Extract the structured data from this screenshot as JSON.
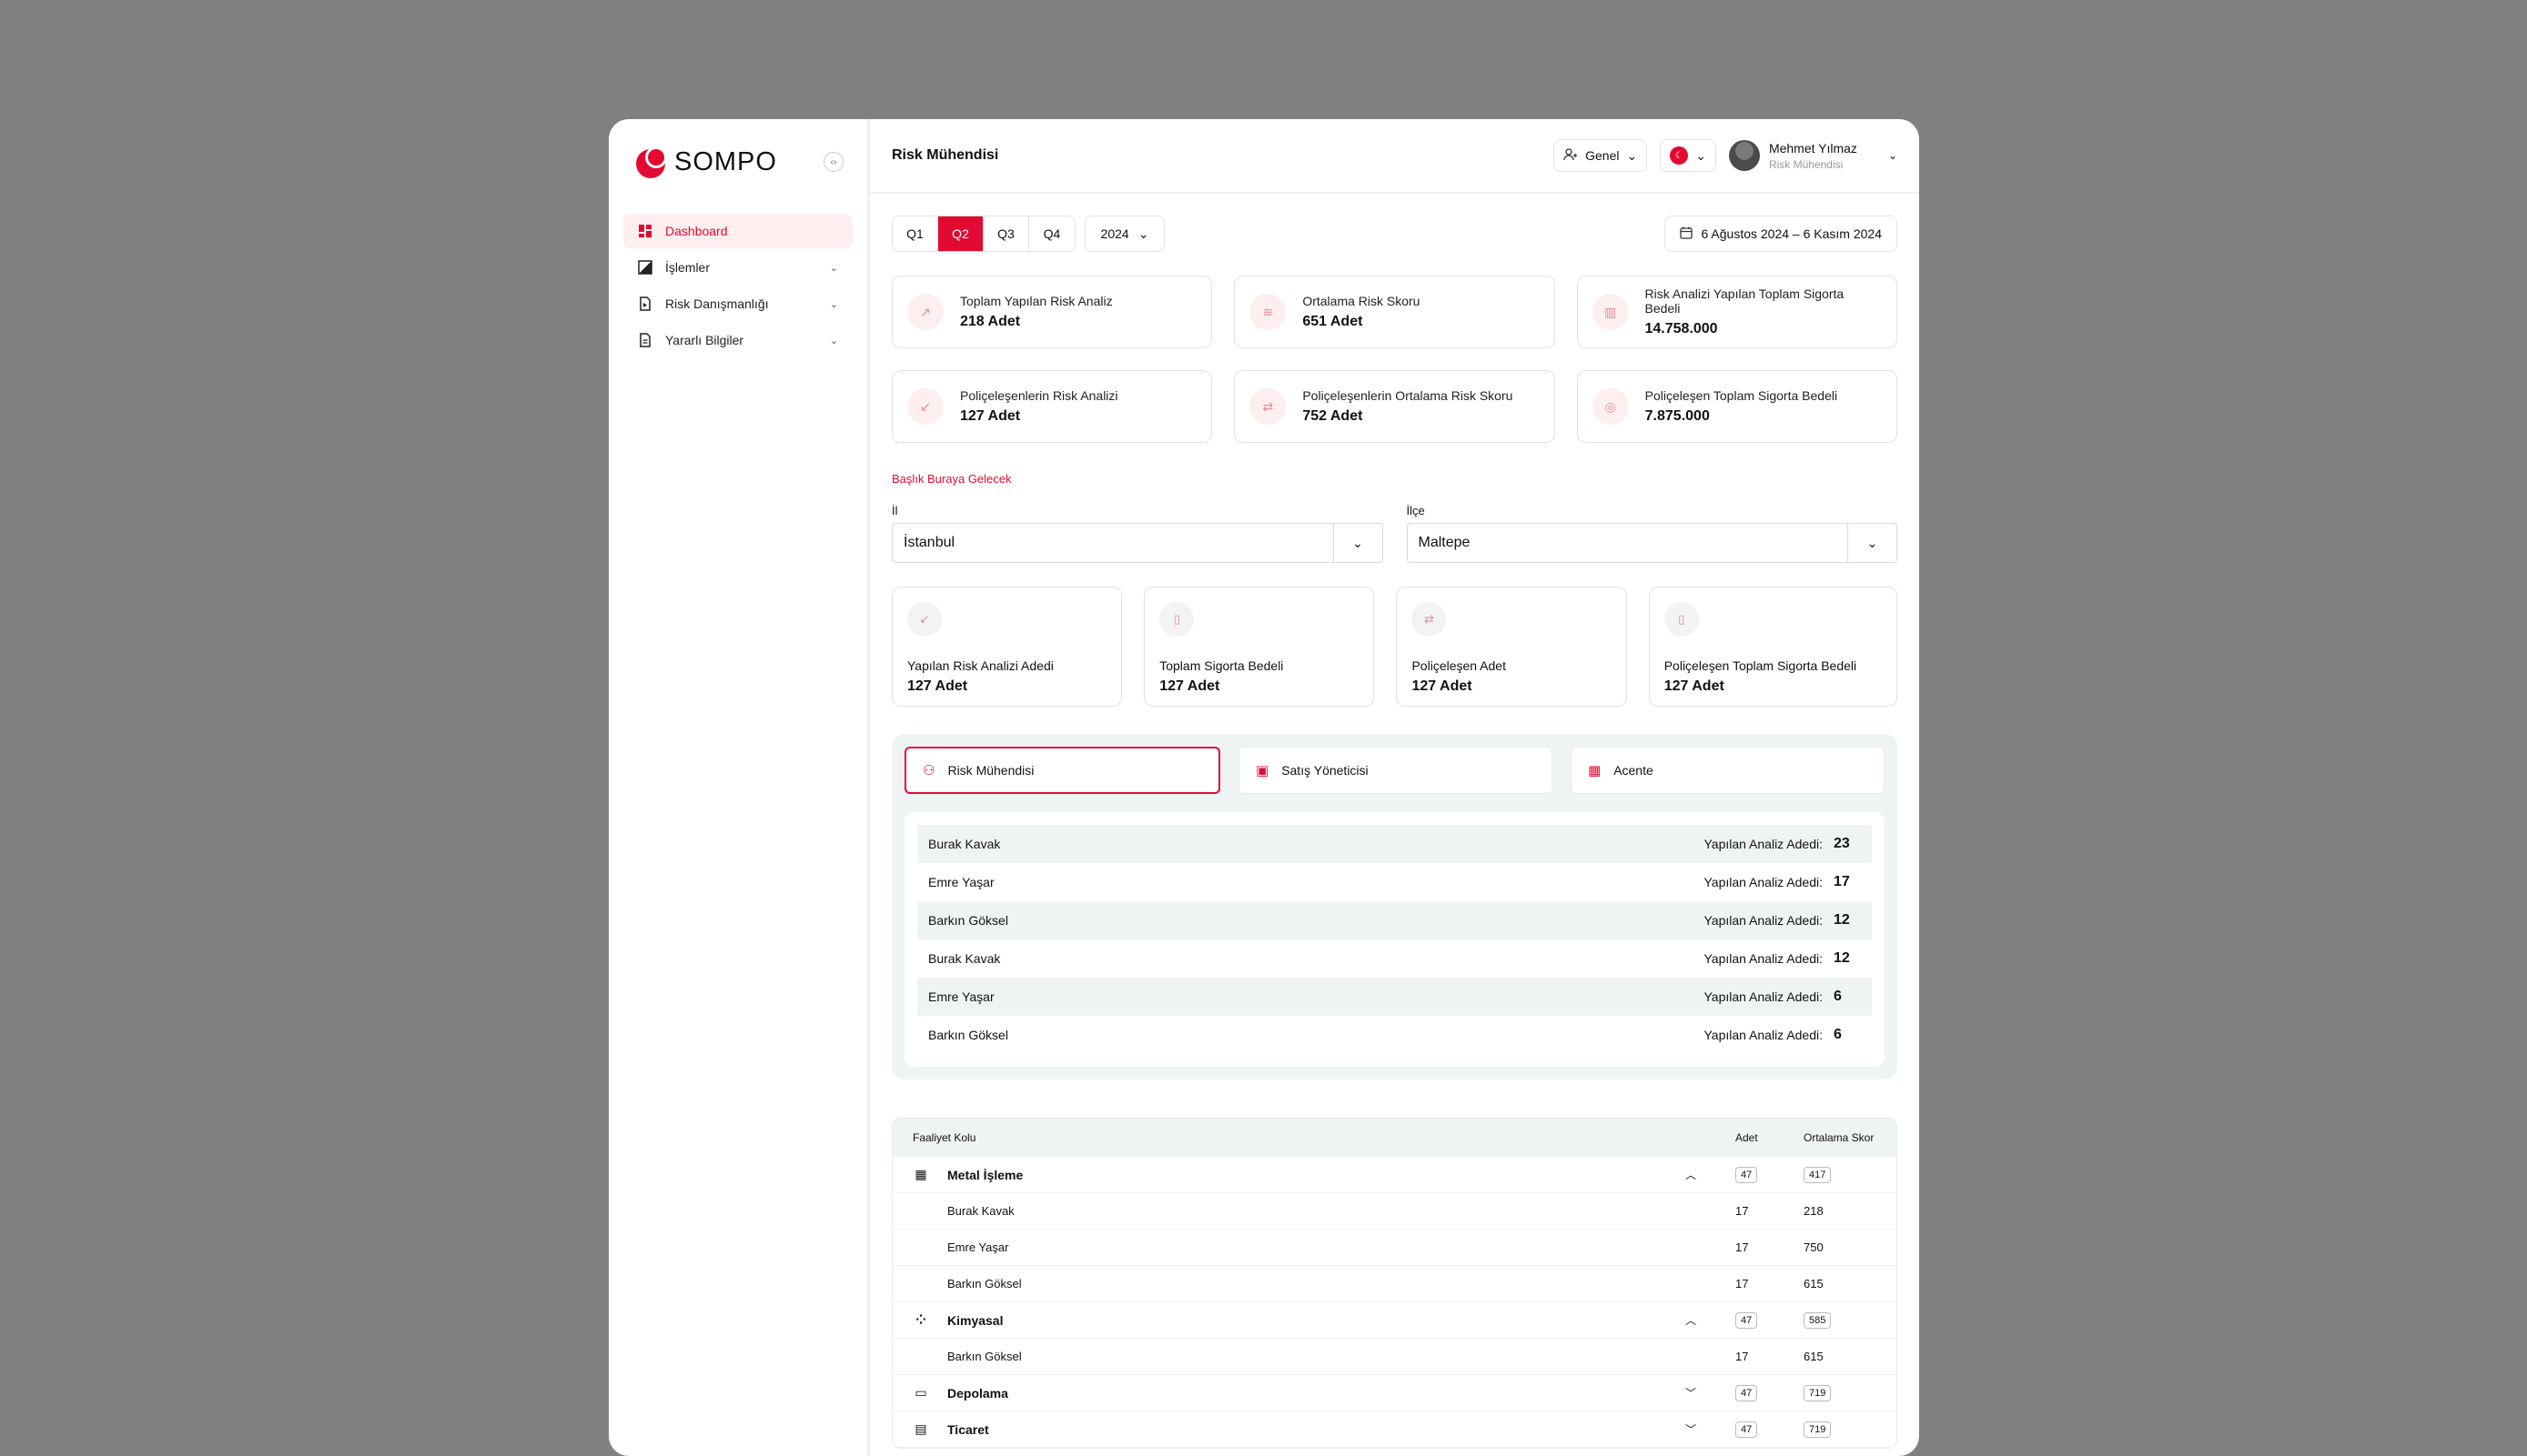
{
  "brand": {
    "name": "SOMPO",
    "accent": "#e30a32"
  },
  "sidebar": {
    "items": [
      {
        "label": "Dashboard",
        "icon": "dashboard-icon",
        "active": true,
        "has_children": false
      },
      {
        "label": "İşlemler",
        "icon": "contrast-icon",
        "active": false,
        "has_children": true
      },
      {
        "label": "Risk Danışmanlığı",
        "icon": "document-play-icon",
        "active": false,
        "has_children": true
      },
      {
        "label": "Yararlı Bilgiler",
        "icon": "document-icon",
        "active": false,
        "has_children": true
      }
    ]
  },
  "header": {
    "title": "Risk Mühendisi",
    "scope": "Genel",
    "user": {
      "name": "Mehmet Yılmaz",
      "role": "Risk Mühendisi"
    }
  },
  "filters": {
    "quarters": [
      "Q1",
      "Q2",
      "Q3",
      "Q4"
    ],
    "active_quarter": "Q2",
    "year": "2024",
    "date_range": "6 Ağustos 2024 – 6 Kasım 2024"
  },
  "stats": [
    {
      "label": "Toplam Yapılan Risk Analiz",
      "value": "218 Adet"
    },
    {
      "label": "Ortalama Risk Skoru",
      "value": "651 Adet"
    },
    {
      "label": "Risk Analizi Yapılan Toplam Sigorta Bedeli",
      "value": "14.758.000"
    },
    {
      "label": "Poliçeleşenlerin Risk Analizi",
      "value": "127 Adet"
    },
    {
      "label": "Poliçeleşenlerin Ortalama Risk Skoru",
      "value": "752 Adet"
    },
    {
      "label": "Poliçeleşen Toplam Sigorta Bedeli",
      "value": "7.875.000"
    }
  ],
  "section": {
    "title": "Başlık Buraya Gelecek",
    "il_label": "İl",
    "il_value": "İstanbul",
    "ilce_label": "İlçe",
    "ilce_value": "Maltepe"
  },
  "metric_cards": [
    {
      "label": "Yapılan Risk Analizi Adedi",
      "value": "127 Adet"
    },
    {
      "label": "Toplam Sigorta Bedeli",
      "value": "127 Adet"
    },
    {
      "label": "Poliçeleşen Adet",
      "value": "127 Adet"
    },
    {
      "label": "Poliçeleşen Toplam Sigorta Bedeli",
      "value": "127 Adet"
    }
  ],
  "role_tabs": [
    {
      "label": "Risk Mühendisi",
      "active": true
    },
    {
      "label": "Satış Yöneticisi",
      "active": false
    },
    {
      "label": "Acente",
      "active": false
    }
  ],
  "ranking": {
    "metric_label": "Yapılan Analiz Adedi:",
    "rows": [
      {
        "name": "Burak Kavak",
        "value": "23"
      },
      {
        "name": "Emre Yaşar",
        "value": "17"
      },
      {
        "name": "Barkın Göksel",
        "value": "12"
      },
      {
        "name": "Burak Kavak",
        "value": "12"
      },
      {
        "name": "Emre Yaşar",
        "value": "6"
      },
      {
        "name": "Barkın Göksel",
        "value": "6"
      }
    ]
  },
  "table": {
    "headers": {
      "name": "Faaliyet Kolu",
      "adet": "Adet",
      "skor": "Ortalama Skor"
    },
    "groups": [
      {
        "name": "Metal İşleme",
        "icon": "factory-icon",
        "expanded": true,
        "adet": "47",
        "skor": "417",
        "children": [
          {
            "name": "Burak Kavak",
            "adet": "17",
            "skor": "218"
          },
          {
            "name": "Emre Yaşar",
            "adet": "17",
            "skor": "750"
          },
          {
            "name": "Barkın Göksel",
            "adet": "17",
            "skor": "615"
          }
        ]
      },
      {
        "name": "Kimyasal",
        "icon": "molecule-icon",
        "expanded": true,
        "adet": "47",
        "skor": "585",
        "children": [
          {
            "name": "Barkın Göksel",
            "adet": "17",
            "skor": "615"
          }
        ]
      },
      {
        "name": "Depolama",
        "icon": "warehouse-icon",
        "expanded": false,
        "adet": "47",
        "skor": "719",
        "children": []
      },
      {
        "name": "Ticaret",
        "icon": "money-icon",
        "expanded": false,
        "adet": "47",
        "skor": "719",
        "children": []
      }
    ]
  }
}
